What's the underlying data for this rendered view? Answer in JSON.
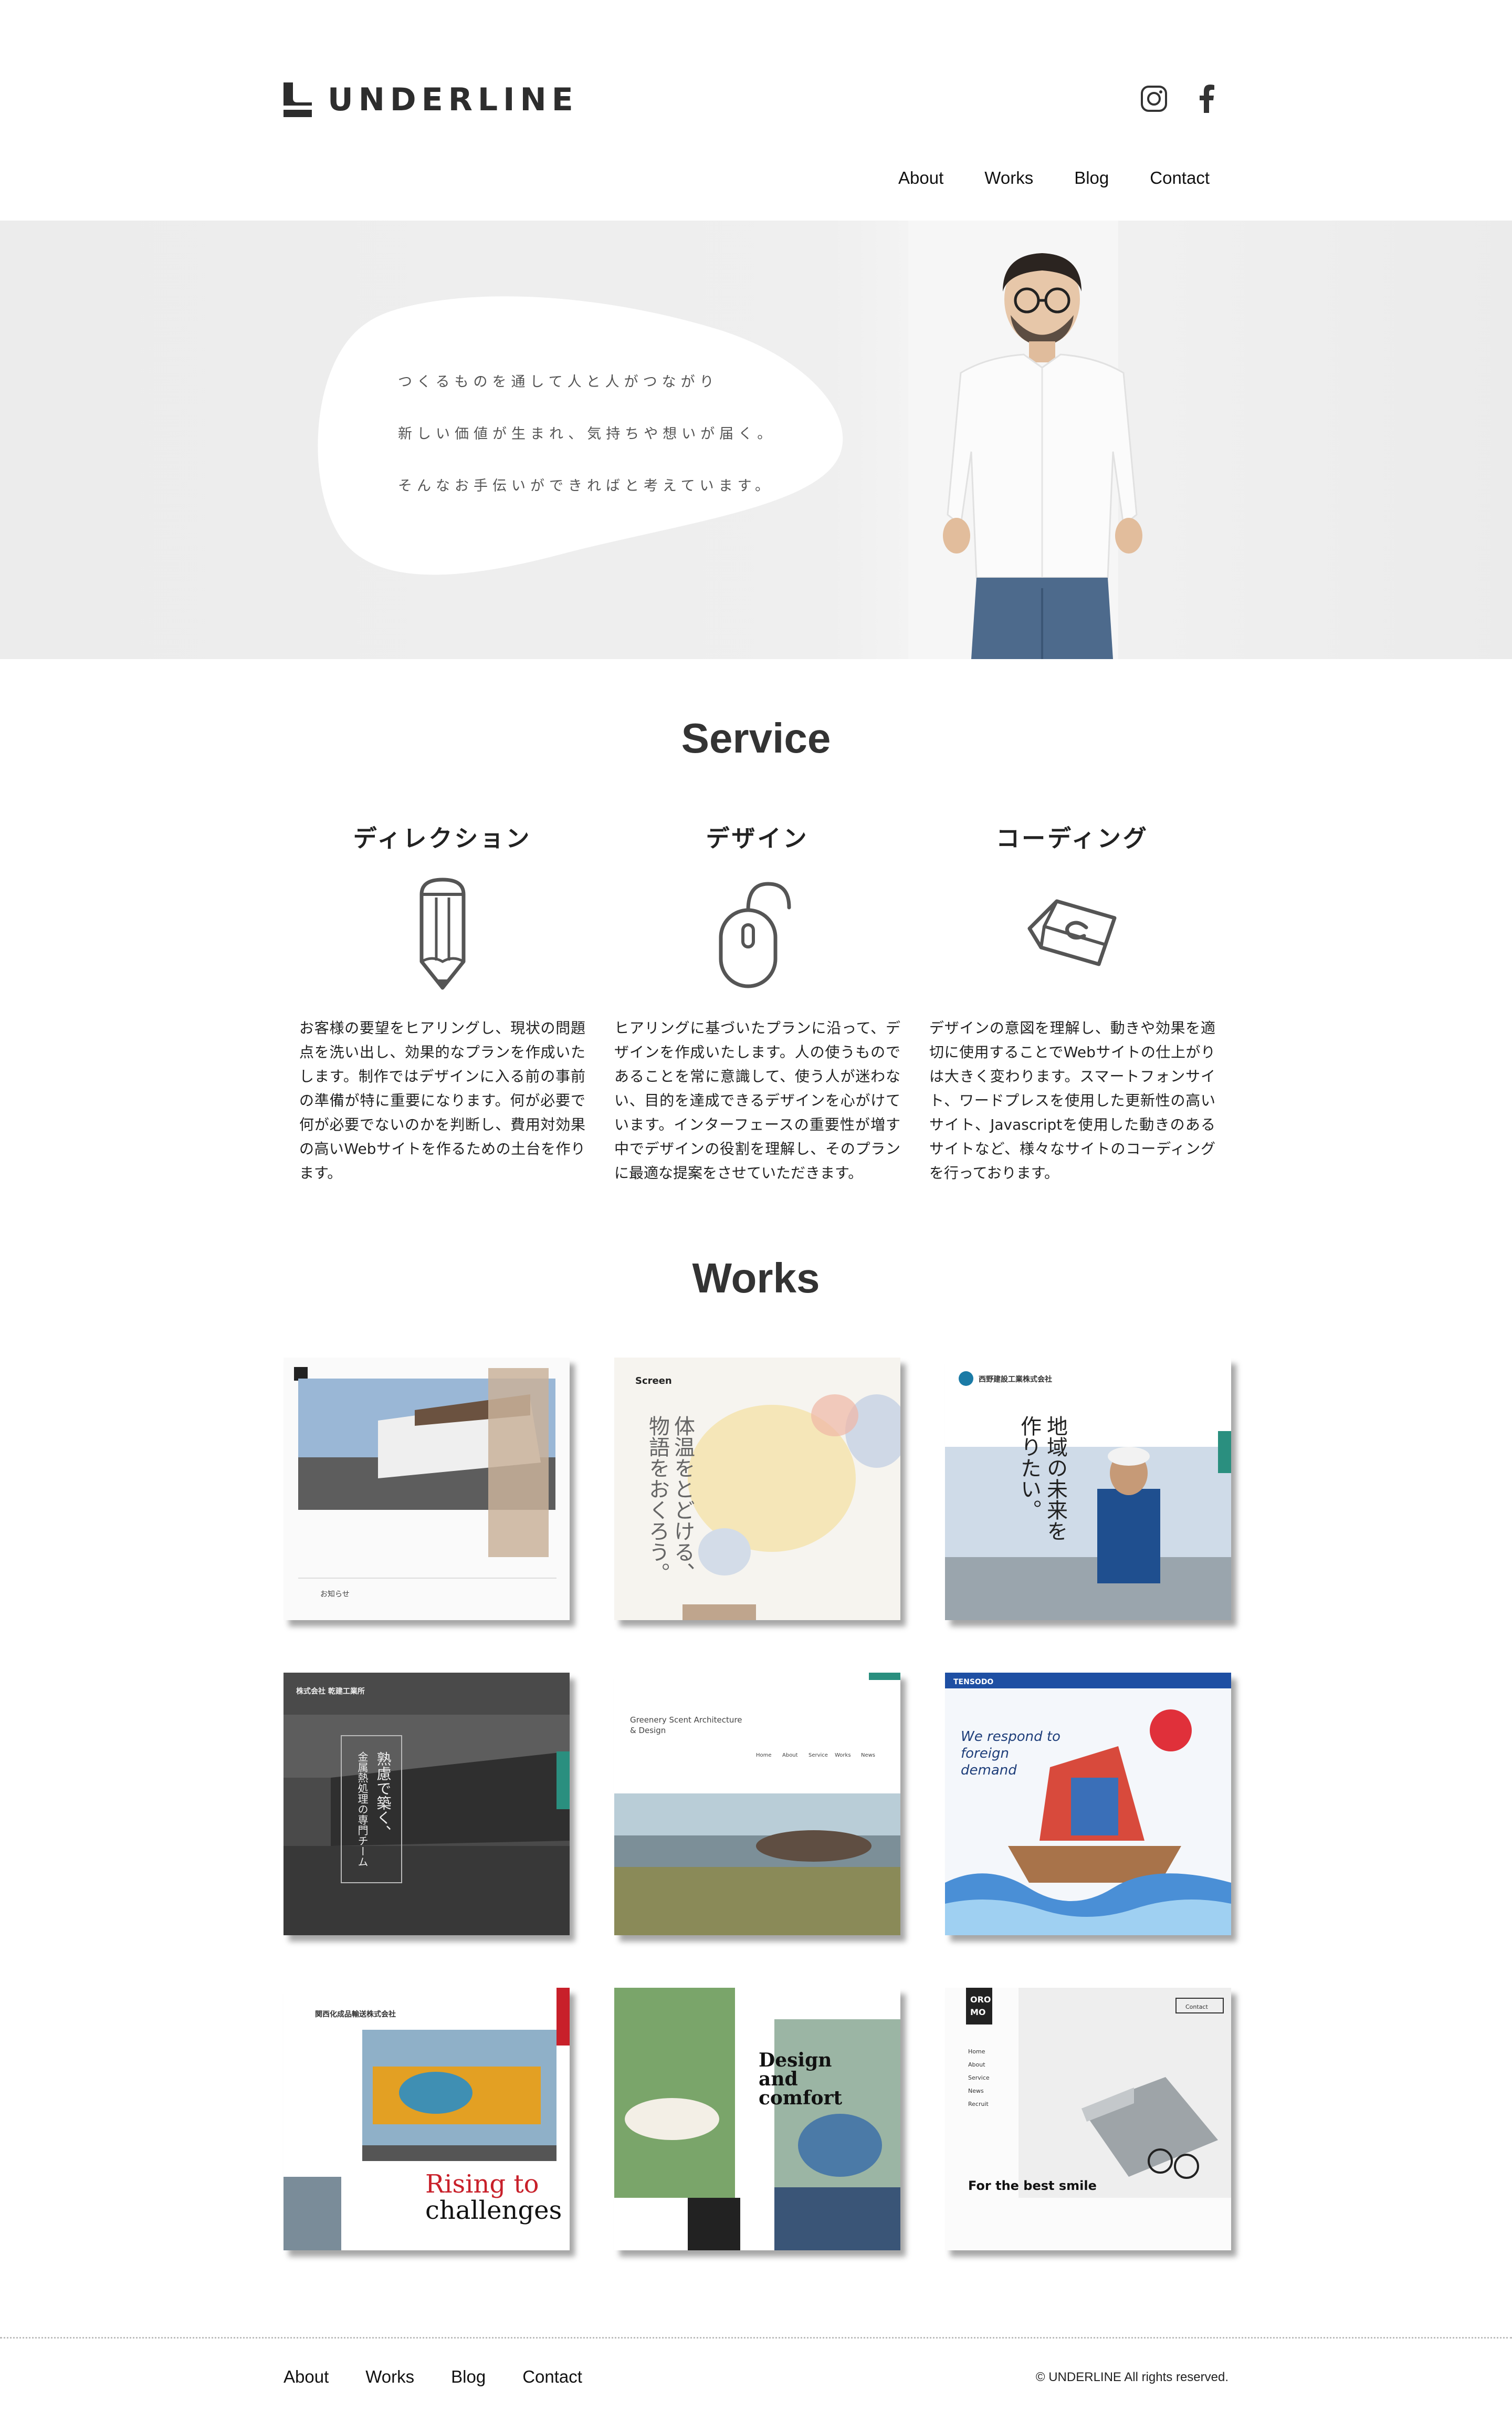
{
  "header": {
    "logo_text": "UNDERLINE",
    "social": [
      {
        "icon": "instagram-icon"
      },
      {
        "icon": "facebook-icon"
      }
    ],
    "nav": [
      "About",
      "Works",
      "Blog",
      "Contact"
    ]
  },
  "hero": {
    "lines": [
      "つくるものを通して人と人がつながり",
      "新しい価値が生まれ、気持ちや想いが届く。",
      "そんなお手伝いができればと考えています。"
    ]
  },
  "service": {
    "title": "Service",
    "items": [
      {
        "name": "ディレクション",
        "icon": "pencil-icon",
        "text": "お客様の要望をヒアリングし、現状の問題点を洗い出し、効果的なプランを作成いたします。制作ではデザインに入る前の事前の準備が特に重要になります。何が必要で何が必要でないのかを判断し、費用対効果の高いWebサイトを作るための土台を作ります。"
      },
      {
        "name": "デザイン",
        "icon": "mouse-icon",
        "text": "ヒアリングに基づいたプランに沿って、デザインを作成いたします。人の使うものであることを常に意識して、使う人が迷わない、目的を達成できるデザインを心がけています。インターフェースの重要性が増す中でデザインの役割を理解し、そのプランに最適な提案をさせていただきます。"
      },
      {
        "name": "コーディング",
        "icon": "keyboard-key-icon",
        "text": "デザインの意図を理解し、動きや効果を適切に使用することでWebサイトの仕上がりは大きく変わります。スマートフォンサイト、ワードプレスを使用した更新性の高いサイト、Javascriptを使用した動きのあるサイトなど、様々なサイトのコーディングを行っております。"
      }
    ]
  },
  "works": {
    "title": "Works",
    "items": [
      {
        "texts": [
          "お知らせ"
        ]
      },
      {
        "texts": [
          "Screen",
          "体温をとどける、",
          "物語をおくろう。"
        ]
      },
      {
        "texts": [
          "西野建設工業株式会社",
          "地域の未来を",
          "作りたい。"
        ]
      },
      {
        "texts": [
          "株式会社 乾建工業所",
          "熟慮で築く、",
          "金属熱処理の専門チーム"
        ]
      },
      {
        "texts": [
          "Greenery Scent Architecture",
          "& Design",
          "Home",
          "About",
          "Service",
          "Works",
          "News"
        ]
      },
      {
        "texts": [
          "TENSODO",
          "We respond to",
          "foreign",
          "demand"
        ]
      },
      {
        "texts": [
          "関西化成品輸送株式会社",
          "Rising to",
          "challenges"
        ]
      },
      {
        "texts": [
          "Design",
          "and",
          "comfort"
        ]
      },
      {
        "texts": [
          "ORO",
          "MO",
          "Home",
          "About",
          "Service",
          "News",
          "Recruit",
          "Contact",
          "For the best smile"
        ]
      }
    ]
  },
  "footer": {
    "nav": [
      "About",
      "Works",
      "Blog",
      "Contact"
    ],
    "copyright": "© UNDERLINE All rights reserved."
  },
  "colors": {
    "text": "#222222",
    "hero_bg": "#ececec",
    "footer_divider": "#bdbdbd",
    "red_accent": "#c8202a",
    "teal_accent": "#2a8f7f"
  }
}
